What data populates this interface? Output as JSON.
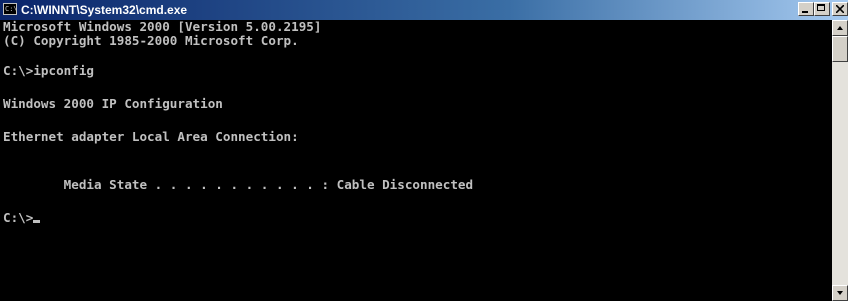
{
  "window": {
    "title": "C:\\WINNT\\System32\\cmd.exe",
    "icon_label": "C:\\"
  },
  "console": {
    "lines": [
      "Microsoft Windows 2000 [Version 5.00.2195]",
      "(C) Copyright 1985-2000 Microsoft Corp.",
      "",
      "C:\\>ipconfig",
      "",
      "Windows 2000 IP Configuration",
      "",
      "Ethernet adapter Local Area Connection:",
      "",
      "        Media State . . . . . . . . . . . : Cable Disconnected",
      "",
      "C:\\>"
    ]
  },
  "colors": {
    "console_background": "#000000",
    "console_text": "#c0c0c0",
    "titlebar_start": "#0a246a",
    "titlebar_end": "#a6caf0"
  },
  "icons": {
    "app": "console-icon",
    "minimize": "minimize-icon",
    "maximize": "maximize-icon",
    "close": "close-icon",
    "scroll_up": "arrow-up-icon",
    "scroll_down": "arrow-down-icon"
  }
}
